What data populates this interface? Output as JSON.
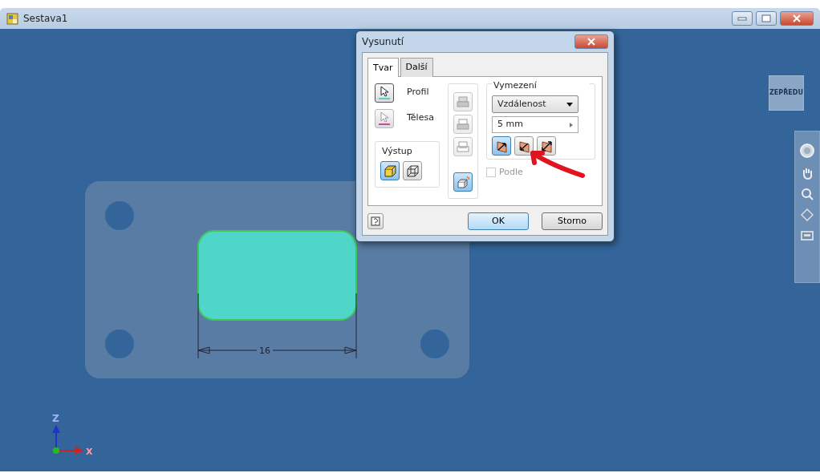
{
  "window": {
    "title": "Sestava1"
  },
  "viewcube": {
    "label": "ZEPŘEDU"
  },
  "sketch": {
    "dimension": "16"
  },
  "axes": {
    "z_label": "Z",
    "x_label": "X"
  },
  "dialog": {
    "title": "Vysunutí",
    "tabs": [
      {
        "label": "Tvar",
        "selected": true
      },
      {
        "label": "Další",
        "selected": false
      }
    ],
    "selectors": [
      {
        "label": "Profil",
        "selected": true
      },
      {
        "label": "Tělesa",
        "selected": false
      }
    ],
    "output": {
      "legend": "Výstup",
      "buttons": [
        {
          "kind": "solid",
          "selected": true
        },
        {
          "kind": "surface",
          "selected": false
        }
      ]
    },
    "operations": [
      {
        "kind": "join",
        "selected": false,
        "disabled": true
      },
      {
        "kind": "cut",
        "selected": false,
        "disabled": true
      },
      {
        "kind": "intersect",
        "selected": false,
        "disabled": true
      },
      {
        "kind": "new_solid",
        "selected": true,
        "disabled": false
      }
    ],
    "extents": {
      "legend": "Vymezení",
      "type": "Vzdálenost",
      "distance": "5 mm",
      "directions": [
        {
          "kind": "forward",
          "selected": true
        },
        {
          "kind": "reverse",
          "selected": false
        },
        {
          "kind": "symmetric",
          "selected": false
        }
      ]
    },
    "checkbox": {
      "label": "Podle",
      "checked": false,
      "disabled": true
    },
    "buttons": [
      {
        "label": "OK",
        "kind": "primary"
      },
      {
        "label": "Storno",
        "kind": "secondary"
      }
    ]
  }
}
